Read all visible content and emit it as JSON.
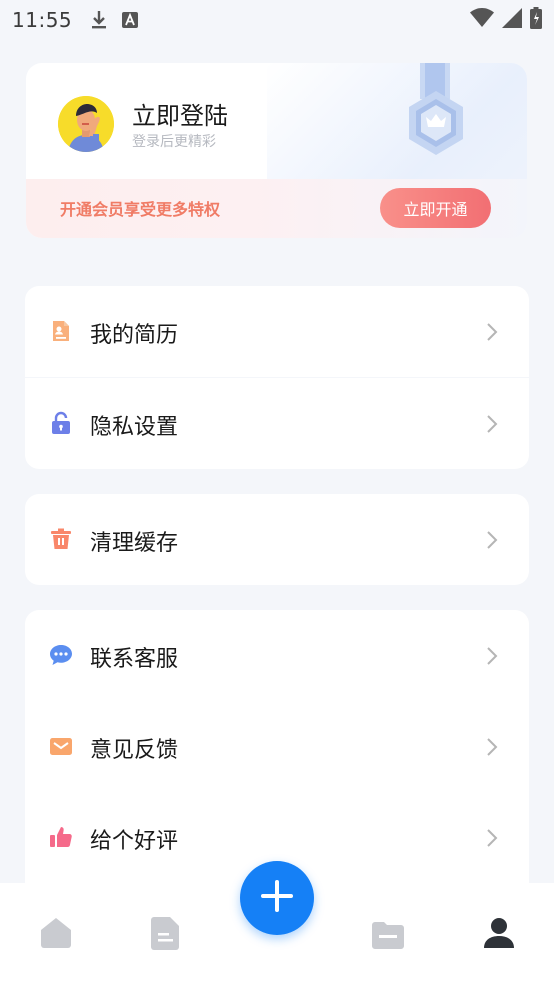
{
  "status_bar": {
    "time": "11:55",
    "left_icons": [
      "download-icon",
      "font-icon"
    ],
    "right_icons": [
      "wifi-icon",
      "signal-icon",
      "battery-icon"
    ]
  },
  "profile": {
    "title": "立即登陆",
    "subtitle": "登录后更精彩",
    "vip_text": "开通会员享受更多特权",
    "vip_button": "立即开通"
  },
  "menu": {
    "resume": {
      "label": "我的简历",
      "icon": "resume-icon"
    },
    "privacy": {
      "label": "隐私设置",
      "icon": "lock-icon"
    },
    "cache": {
      "label": "清理缓存",
      "icon": "trash-icon"
    },
    "service": {
      "label": "联系客服",
      "icon": "chat-icon"
    },
    "feedback": {
      "label": "意见反馈",
      "icon": "mail-icon"
    },
    "rate": {
      "label": "给个好评",
      "icon": "thumbs-up-icon"
    }
  },
  "bottom_nav": {
    "items": [
      "home-icon",
      "document-icon",
      "add-icon",
      "folder-icon",
      "profile-icon"
    ],
    "active": "profile-icon"
  },
  "colors": {
    "accent": "#1580f6",
    "vip_button": "#f26f73",
    "vip_text": "#f07c66",
    "background": "#f4f6fa"
  }
}
